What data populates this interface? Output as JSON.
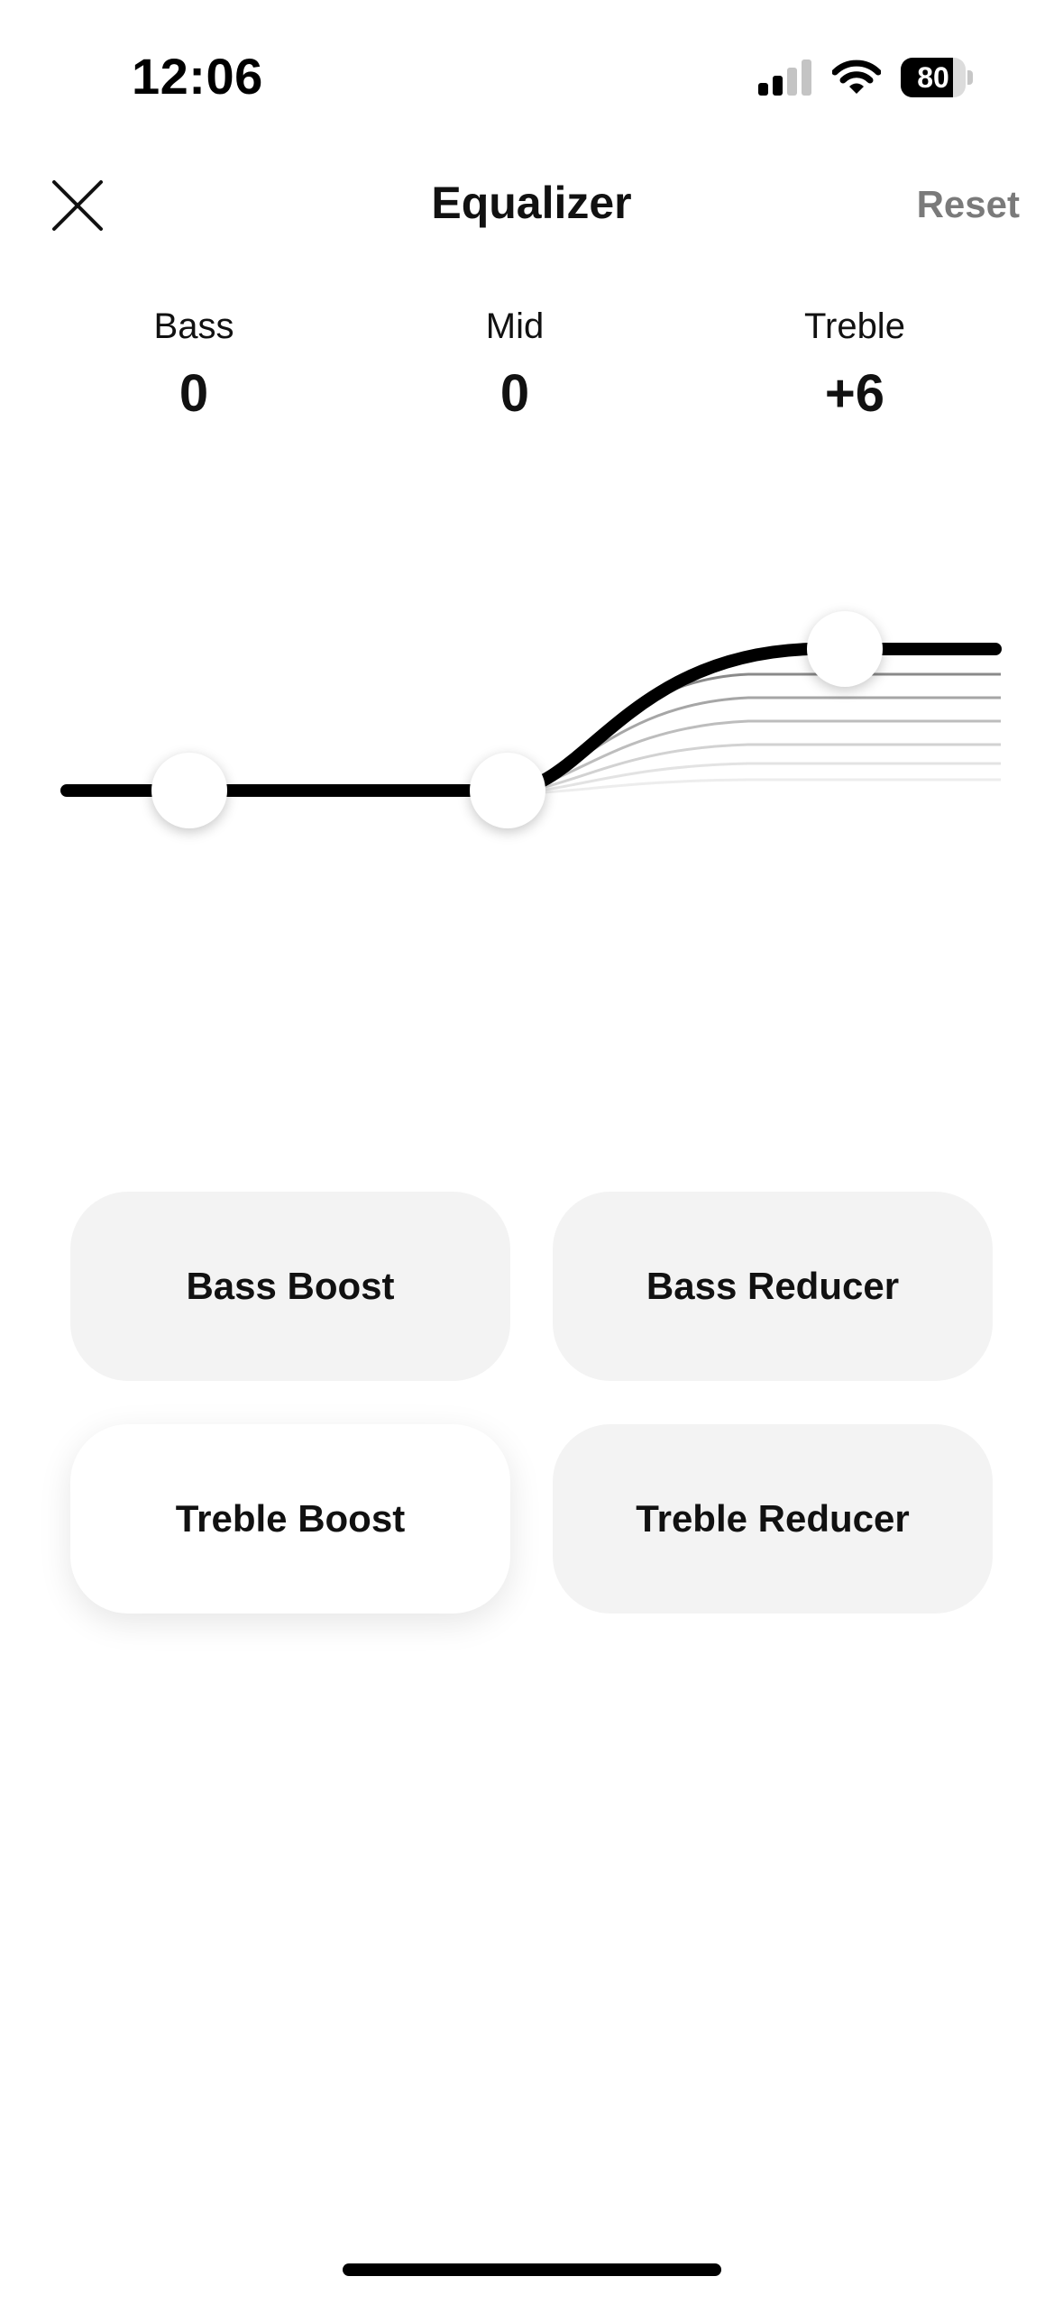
{
  "status_bar": {
    "time": "12:06",
    "battery_level": "80",
    "battery_fraction": 0.8,
    "signal_bars_active": 2,
    "signal_bars_total": 4
  },
  "header": {
    "title": "Equalizer",
    "reset_label": "Reset"
  },
  "bands": [
    {
      "label": "Bass",
      "value": "0"
    },
    {
      "label": "Mid",
      "value": "0"
    },
    {
      "label": "Treble",
      "value": "+6"
    }
  ],
  "presets": [
    {
      "label": "Bass Boost",
      "active": false
    },
    {
      "label": "Bass Reducer",
      "active": false
    },
    {
      "label": "Treble Boost",
      "active": true
    },
    {
      "label": "Treble Reducer",
      "active": false
    }
  ],
  "colors": {
    "accent": "#000000",
    "reset_text": "#7a7a7a",
    "preset_bg": "#f3f3f3",
    "preset_active_bg": "#ffffff"
  },
  "icons": {
    "close": "close-icon",
    "signal": "cellular-signal-icon",
    "wifi": "wifi-icon",
    "battery": "battery-icon"
  }
}
